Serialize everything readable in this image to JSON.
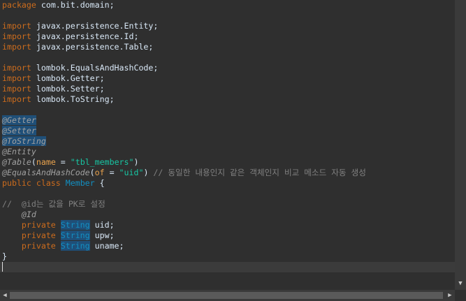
{
  "code": {
    "l1_kw": "package",
    "l1_rest": " com.bit.domain;",
    "imp_kw": "import",
    "l3": " javax.persistence.Entity;",
    "l4": " javax.persistence.Id;",
    "l5": " javax.persistence.Table;",
    "l7": " lombok.EqualsAndHashCode;",
    "l8": " lombok.Getter;",
    "l9": " lombok.Setter;",
    "l10": " lombok.ToString;",
    "a_getter": "@Getter",
    "a_setter": "@Setter",
    "a_tostring": "@ToString",
    "a_entity": "@Entity",
    "a_table": "@Table",
    "a_table_paren_open": "(",
    "a_table_attr": "name",
    "a_table_eq": " = ",
    "a_table_val": "\"tbl_members\"",
    "a_table_paren_close": ")",
    "a_eq": "@EqualsAndHashCode",
    "a_eq_paren_open": "(",
    "a_eq_attr": "of",
    "a_eq_eq": " = ",
    "a_eq_val": "\"uid\"",
    "a_eq_paren_close": ")",
    "a_eq_comment": " // 동일한 내용인지 같은 객체인지 비교 메소드 자동 생성",
    "class_public": "public",
    "class_kw": " class",
    "class_name": " Member",
    "class_brace": " {",
    "c_comment": "//  @id는 값을 PK로 설정",
    "id_ann": "    @Id",
    "priv": "    private",
    "type_string": "String",
    "f_uid": " uid;",
    "f_upw": " upw;",
    "f_uname": " uname;",
    "close_brace": "}"
  },
  "scroll": {
    "down_arrow": "▼",
    "left_arrow": "◀",
    "right_arrow": "▶"
  }
}
